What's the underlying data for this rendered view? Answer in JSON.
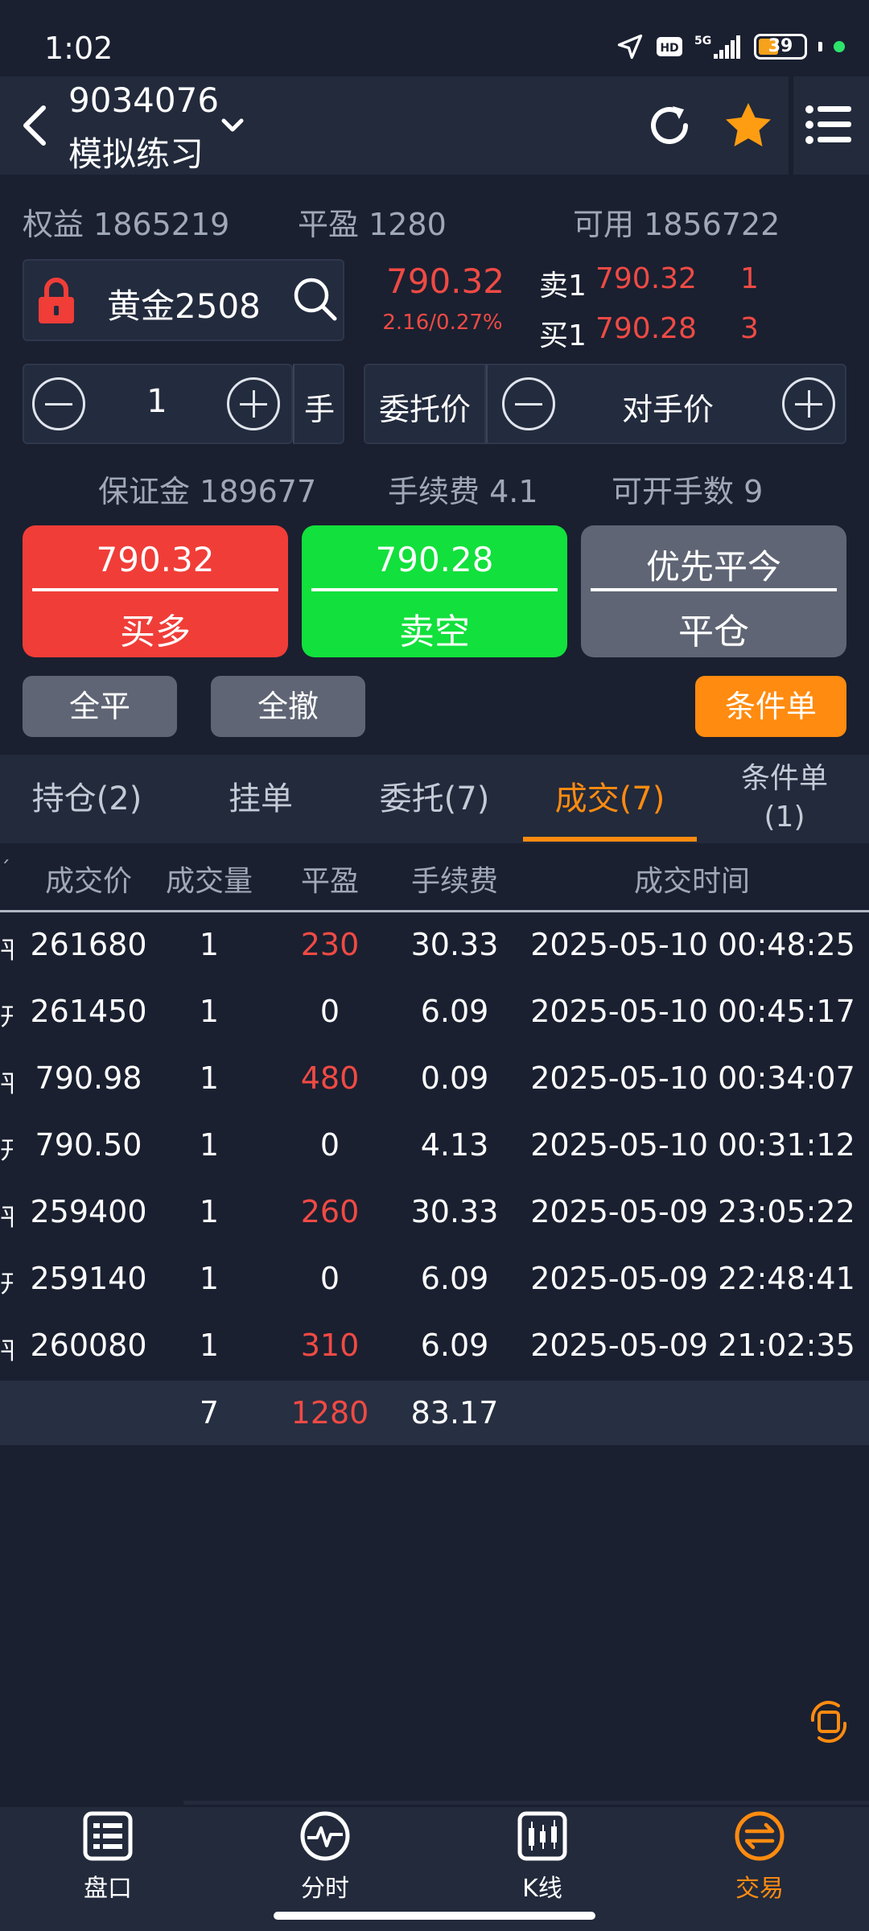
{
  "status_bar": {
    "time": "1:02",
    "battery": "39"
  },
  "header": {
    "account_id": "9034076",
    "account_name": "模拟练习"
  },
  "summary": {
    "equity": "权益 1865219",
    "flat_pl": "平盈 1280",
    "available": "可用 1856722"
  },
  "instrument": {
    "name": "黄金2508",
    "last_price": "790.32",
    "change": "2.16/0.27%",
    "ask_label": "卖1",
    "ask_price": "790.32",
    "ask_qty": "1",
    "bid_label": "买1",
    "bid_price": "790.28",
    "bid_qty": "3"
  },
  "order": {
    "quantity": "1",
    "unit": "手",
    "price_type_label": "委托价",
    "price_mode": "对手价"
  },
  "margin_row": {
    "margin": "保证金 189677",
    "fee": "手续费 4.1",
    "max_lots": "可开手数 9"
  },
  "buttons": {
    "buy_price": "790.32",
    "buy_label": "买多",
    "sell_price": "790.28",
    "sell_label": "卖空",
    "close_top": "优先平今",
    "close_label": "平仓",
    "close_all": "全平",
    "cancel_all": "全撤",
    "conditional": "条件单"
  },
  "tabs": {
    "positions": "持仓(2)",
    "pending": "挂单",
    "orders": "委托(7)",
    "trades": "成交(7)",
    "cond_line1": "条件单",
    "cond_line2": "(1)"
  },
  "table": {
    "headers": [
      "成交价",
      "成交量",
      "平盈",
      "手续费",
      "成交时间"
    ],
    "rows": [
      {
        "side": "平",
        "price": "261680",
        "qty": "1",
        "pl": "230",
        "fee": "30.33",
        "time": "2025-05-10 00:48:25"
      },
      {
        "side": "开",
        "price": "261450",
        "qty": "1",
        "pl": "0",
        "fee": "6.09",
        "time": "2025-05-10 00:45:17"
      },
      {
        "side": "平",
        "price": "790.98",
        "qty": "1",
        "pl": "480",
        "fee": "0.09",
        "time": "2025-05-10 00:34:07"
      },
      {
        "side": "开",
        "price": "790.50",
        "qty": "1",
        "pl": "0",
        "fee": "4.13",
        "time": "2025-05-10 00:31:12"
      },
      {
        "side": "平",
        "price": "259400",
        "qty": "1",
        "pl": "260",
        "fee": "30.33",
        "time": "2025-05-09 23:05:22"
      },
      {
        "side": "开",
        "price": "259140",
        "qty": "1",
        "pl": "0",
        "fee": "6.09",
        "time": "2025-05-09 22:48:41"
      },
      {
        "side": "平",
        "price": "260080",
        "qty": "1",
        "pl": "310",
        "fee": "6.09",
        "time": "2025-05-09 21:02:35"
      }
    ],
    "total": {
      "qty": "7",
      "pl": "1280",
      "fee": "83.17"
    }
  },
  "bottom_nav": {
    "orderbook": "盘口",
    "timeshare": "分时",
    "kline": "K线",
    "trade": "交易"
  },
  "colors": {
    "accent": "#ff8b10",
    "up": "#f04a44",
    "down": "#12e03c",
    "bg": "#1a2030"
  }
}
